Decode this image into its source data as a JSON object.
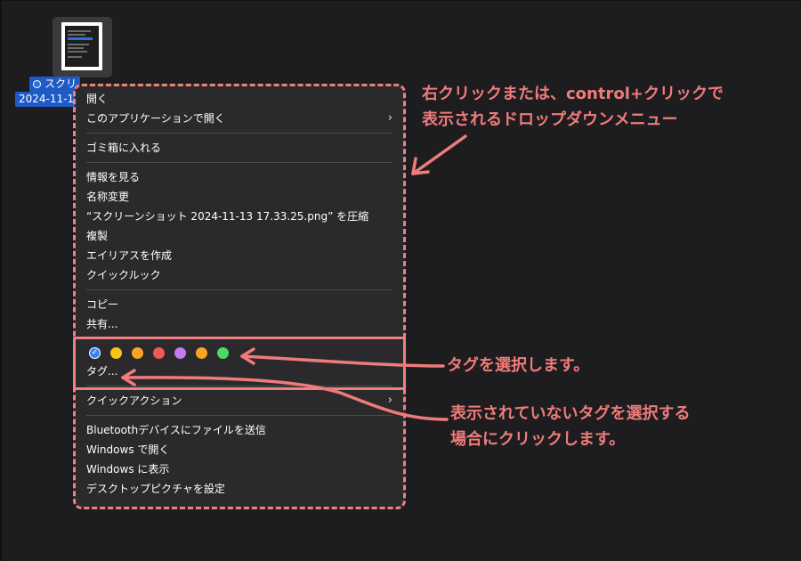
{
  "file": {
    "name_line1": "スクリ",
    "name_line2": "2024-11-13",
    "tag_color": "#2b6fe0"
  },
  "menu": {
    "groups": [
      {
        "items": [
          {
            "label": "開く",
            "submenu": false
          },
          {
            "label": "このアプリケーションで開く",
            "submenu": true
          }
        ]
      },
      {
        "items": [
          {
            "label": "ゴミ箱に入れる",
            "submenu": false
          }
        ]
      },
      {
        "items": [
          {
            "label": "情報を見る",
            "submenu": false
          },
          {
            "label": "名称変更",
            "submenu": false
          },
          {
            "label": "“スクリーンショット 2024-11-13 17.33.25.png” を圧縮",
            "submenu": false
          },
          {
            "label": "複製",
            "submenu": false
          },
          {
            "label": "エイリアスを作成",
            "submenu": false
          },
          {
            "label": "クイックルック",
            "submenu": false
          }
        ]
      },
      {
        "items": [
          {
            "label": "コピー",
            "submenu": false
          },
          {
            "label": "共有...",
            "submenu": false
          }
        ]
      }
    ],
    "tag_colors": [
      {
        "name": "blue",
        "color": "#3b82f6",
        "checked": true
      },
      {
        "name": "yellow",
        "color": "#f5c518",
        "checked": false
      },
      {
        "name": "orange",
        "color": "#f5a623",
        "checked": false
      },
      {
        "name": "red",
        "color": "#f05a50",
        "checked": false
      },
      {
        "name": "purple",
        "color": "#c47af0",
        "checked": false
      },
      {
        "name": "orange2",
        "color": "#f5a623",
        "checked": false
      },
      {
        "name": "green",
        "color": "#4cd964",
        "checked": false
      }
    ],
    "check_glyph": "✓",
    "tags_label": "タグ...",
    "quick_actions": {
      "label": "クイックアクション",
      "submenu": true
    },
    "bottom_items": [
      {
        "label": "Bluetoothデバイスにファイルを送信"
      },
      {
        "label": "Windows で開く"
      },
      {
        "label": "Windows に表示"
      },
      {
        "label": "デスクトップピクチャを設定"
      }
    ],
    "chevron_glyph": "›"
  },
  "annotations": {
    "menu_note_line1": "右クリックまたは、control+クリックで",
    "menu_note_line2": "表示されるドロップダウンメニュー",
    "tag_select_note": "タグを選択します。",
    "hidden_tag_note_line1": "表示されていないタグを選択する",
    "hidden_tag_note_line2": "場合にクリックします。",
    "accent_color": "#f07b7b"
  }
}
